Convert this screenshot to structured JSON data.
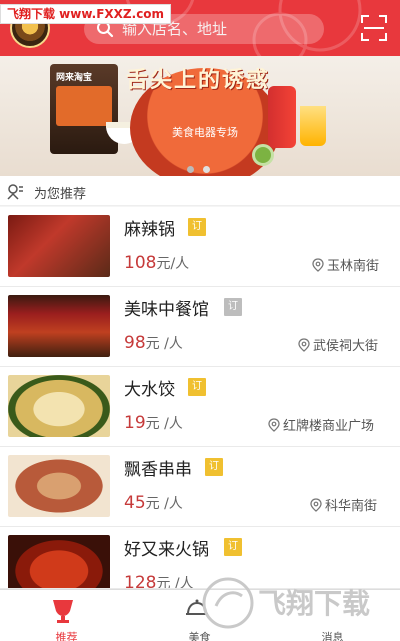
{
  "watermark": {
    "text": "飞翔下载 www.FXXZ.com"
  },
  "header": {
    "search_placeholder": "输入店名、地址",
    "colors": {
      "bg": "#e8383d"
    }
  },
  "banner": {
    "title": "舌尖上的诱惑",
    "subtitle": "美食电器专场",
    "oven_label": "网来淘宝",
    "page_dots": [
      {
        "active": true
      },
      {
        "active": false
      }
    ]
  },
  "section": {
    "title": "为您推荐"
  },
  "restaurants": [
    {
      "name": "麻辣锅",
      "tag": "订",
      "tag_color": "#f0c030",
      "price": "108",
      "unit": "元/人",
      "location": "玉林南街"
    },
    {
      "name": "美味中餐馆",
      "tag": "订",
      "tag_color": "#bdbdbd",
      "price": "98",
      "unit": "元 /人",
      "location": "武侯祠大街"
    },
    {
      "name": "大水饺",
      "tag": "订",
      "tag_color": "#f0c030",
      "price": "19",
      "unit": "元 /人",
      "location": "红牌楼商业广场"
    },
    {
      "name": "飘香串串",
      "tag": "订",
      "tag_color": "#f0c030",
      "price": "45",
      "unit": "元 /人",
      "location": "科华南街"
    },
    {
      "name": "好又来火锅",
      "tag": "订",
      "tag_color": "#f0c030",
      "price": "128",
      "unit": "元 /人",
      "location": ""
    }
  ],
  "tabs": [
    {
      "label": "推荐",
      "active": true,
      "icon": "trophy-icon"
    },
    {
      "label": "美食",
      "active": false,
      "icon": "dish-icon"
    },
    {
      "label": "消息",
      "active": false,
      "icon": "message-icon"
    }
  ],
  "overlay_logo": {
    "text": "飞翔下载"
  },
  "colors": {
    "accent": "#e8383d",
    "price": "#c63a3a",
    "tab_active": "#e8383d",
    "tab_inactive": "#555555"
  }
}
